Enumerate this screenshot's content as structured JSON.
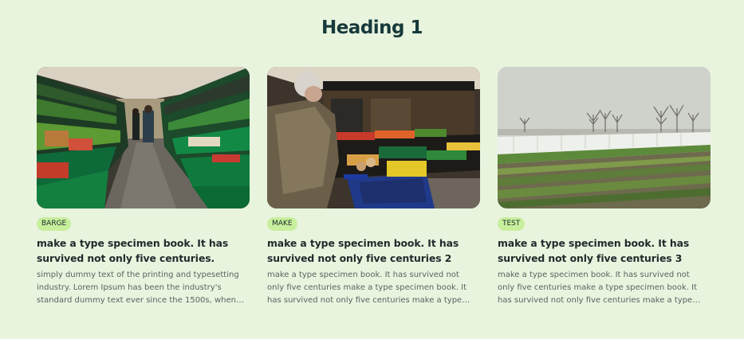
{
  "section": {
    "heading": "Heading 1"
  },
  "cards": [
    {
      "tag": "BARGE",
      "title": "make a type specimen book. It has survived not only five centuries.",
      "description": "simply dummy text of the printing and typesetting industry. Lorem Ipsum has been the industry's standard dummy text ever since the 1500s, when an unknown printer took a galley of type and scrambled it",
      "image": "grocery-produce-aisle"
    },
    {
      "tag": "MAKE",
      "title": "make a type specimen book. It has survived not only five centuries 2",
      "description": "make a type specimen book. It has survived not only five centuries make a type specimen book. It has survived not only five centuries make a type specimen book. It has survived",
      "image": "shopper-with-cart"
    },
    {
      "tag": "TEST",
      "title": "make a type specimen book. It has survived not only five centuries 3",
      "description": "make a type specimen book. It has survived not only five centuries make a type specimen book. It has survived not only five centuries make a type specimen book. It has survived",
      "image": "greenhouse-field"
    }
  ],
  "colors": {
    "background": "#e8f4de",
    "tag_background": "#c7ef9c",
    "heading": "#17393b"
  }
}
